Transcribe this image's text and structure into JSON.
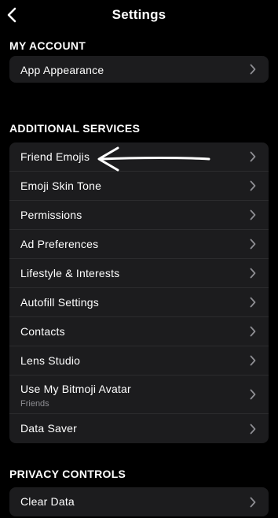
{
  "header": {
    "title": "Settings",
    "back_icon": "chevron-left-icon"
  },
  "sections": {
    "my_account": {
      "title": "MY ACCOUNT",
      "items": [
        {
          "label": "App Appearance"
        }
      ]
    },
    "additional_services": {
      "title": "ADDITIONAL SERVICES",
      "items": [
        {
          "label": "Friend Emojis"
        },
        {
          "label": "Emoji Skin Tone"
        },
        {
          "label": "Permissions"
        },
        {
          "label": "Ad Preferences"
        },
        {
          "label": "Lifestyle & Interests"
        },
        {
          "label": "Autofill Settings"
        },
        {
          "label": "Contacts"
        },
        {
          "label": "Lens Studio"
        },
        {
          "label": "Use My Bitmoji Avatar",
          "sublabel": "Friends"
        },
        {
          "label": "Data Saver"
        }
      ]
    },
    "privacy_controls": {
      "title": "PRIVACY CONTROLS",
      "items": [
        {
          "label": "Clear Data"
        }
      ]
    }
  },
  "colors": {
    "background": "#000000",
    "row_background": "#1c1c1e",
    "separator": "#2c2c2e",
    "text": "#ffffff",
    "secondary_text": "#8e8e93",
    "chevron": "#8e8e93"
  }
}
